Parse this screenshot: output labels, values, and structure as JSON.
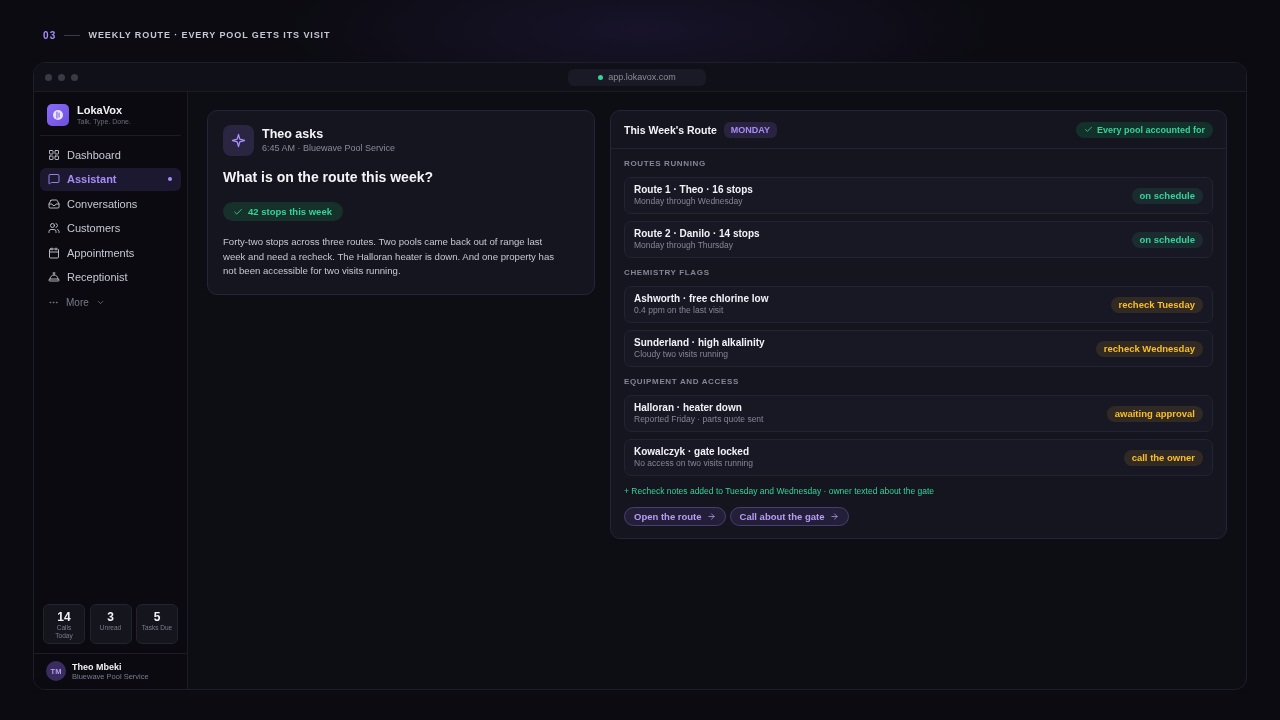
{
  "header": {
    "number": "03",
    "title": "WEEKLY ROUTE · EVERY POOL GETS ITS VISIT"
  },
  "window": {
    "address": "app.lokavox.com"
  },
  "sidebar": {
    "brand": {
      "name": "LokaVox",
      "tagline": "Talk. Type. Done."
    },
    "items": [
      {
        "label": "Dashboard",
        "selected": false
      },
      {
        "label": "Assistant",
        "selected": true
      },
      {
        "label": "Conversations",
        "selected": false
      },
      {
        "label": "Customers",
        "selected": false
      },
      {
        "label": "Appointments",
        "selected": false
      },
      {
        "label": "Receptionist",
        "selected": false
      }
    ],
    "more": "More",
    "stats": [
      {
        "value": "14",
        "label": "Calls Today"
      },
      {
        "value": "3",
        "label": "Unread"
      },
      {
        "value": "5",
        "label": "Tasks Due"
      }
    ],
    "user": {
      "initials": "TM",
      "name": "Theo Mbeki",
      "company": "Bluewave Pool Service"
    }
  },
  "question_card": {
    "asker": "Theo asks",
    "meta": "6:45 AM · Bluewave Pool Service",
    "question": "What is on the route this week?",
    "badge": "42 stops this week",
    "answer": "Forty-two stops across three routes. Two pools came back out of range last week and need a recheck. The Halloran heater is down. And one property has not been accessible for two visits running."
  },
  "route_card": {
    "title": "This Week's Route",
    "day": "MONDAY",
    "summary": "Every pool accounted for",
    "sections": [
      {
        "heading": "ROUTES RUNNING",
        "rows": [
          {
            "title": "Route 1 · Theo · 16 stops",
            "detail": "Monday through Wednesday",
            "status": {
              "text": "on schedule",
              "color": "#34d399"
            }
          },
          {
            "title": "Route 2 · Danilo · 14 stops",
            "detail": "Monday through Thursday",
            "status": {
              "text": "on schedule",
              "color": "#34d399"
            }
          }
        ]
      },
      {
        "heading": "CHEMISTRY FLAGS",
        "rows": [
          {
            "title": "Ashworth · free chlorine low",
            "detail": "0.4 ppm on the last visit",
            "status": {
              "text": "recheck Tuesday",
              "color": "#fbbf24"
            }
          },
          {
            "title": "Sunderland · high alkalinity",
            "detail": "Cloudy two visits running",
            "status": {
              "text": "recheck Wednesday",
              "color": "#fbbf24"
            }
          }
        ]
      },
      {
        "heading": "EQUIPMENT AND ACCESS",
        "rows": [
          {
            "title": "Halloran · heater down",
            "detail": "Reported Friday · parts quote sent",
            "status": {
              "text": "awaiting approval",
              "color": "#fbbf24"
            }
          },
          {
            "title": "Kowalczyk · gate locked",
            "detail": "No access on two visits running",
            "status": {
              "text": "call the owner",
              "color": "#fbbf24"
            }
          }
        ]
      }
    ],
    "note": "+ Recheck notes added to Tuesday and Wednesday · owner texted about the gate",
    "actions": [
      "Open the route",
      "Call about the gate"
    ]
  }
}
